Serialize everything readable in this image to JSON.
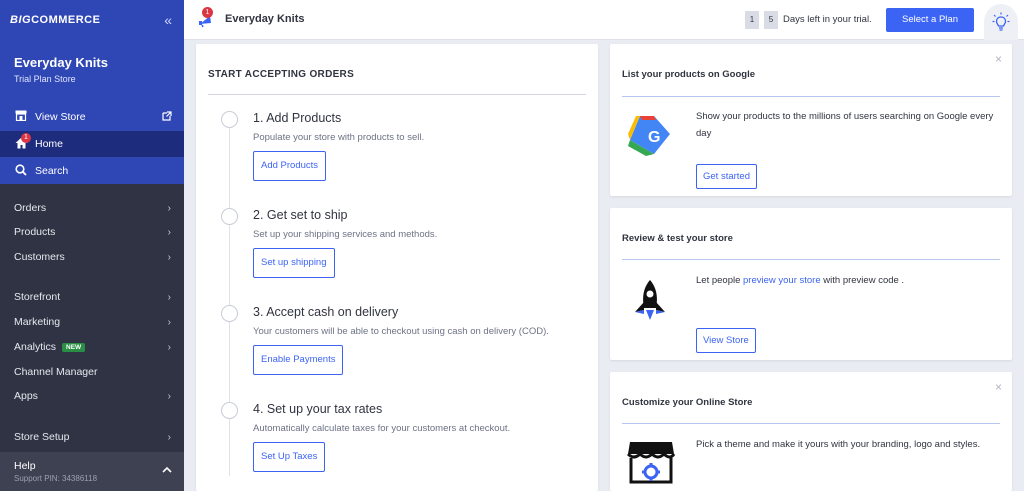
{
  "sidebar": {
    "logo_big": "BIG",
    "logo_commerce": "COMMERCE",
    "collapse_icon": "«",
    "store_name": "Everyday Knits",
    "store_plan": "Trial Plan Store",
    "view_store": "View Store",
    "home": "Home",
    "home_badge": "1",
    "search": "Search",
    "nav": [
      {
        "label": "Orders"
      },
      {
        "label": "Products"
      },
      {
        "label": "Customers"
      },
      {
        "label": "Storefront"
      },
      {
        "label": "Marketing"
      },
      {
        "label": "Analytics",
        "badge": "NEW"
      },
      {
        "label": "Channel Manager"
      },
      {
        "label": "Apps"
      },
      {
        "label": "Store Setup"
      }
    ],
    "help_label": "Help",
    "help_pin": "Support PIN: 34386118"
  },
  "topbar": {
    "notification_badge": "1",
    "title": "Everyday Knits",
    "days_digits": [
      "1",
      "5"
    ],
    "days_text": "Days left in your trial.",
    "select_plan": "Select a Plan"
  },
  "orders_card": {
    "title": "START ACCEPTING ORDERS",
    "steps": [
      {
        "title": "1. Add Products",
        "desc": "Populate your store with products to sell.",
        "button": "Add Products"
      },
      {
        "title": "2. Get set to ship",
        "desc": "Set up your shipping services and methods.",
        "button": "Set up shipping"
      },
      {
        "title": "3. Accept cash on delivery",
        "desc": "Your customers will be able to checkout using cash on delivery (COD).",
        "button": "Enable Payments"
      },
      {
        "title": "4. Set up your tax rates",
        "desc": "Automatically calculate taxes for your customers at checkout.",
        "button": "Set Up Taxes"
      }
    ]
  },
  "google_card": {
    "title": "List your products on Google",
    "text": "Show your products to the millions of users searching on Google every day",
    "button": "Get started",
    "close": "×"
  },
  "review_card": {
    "title": "Review & test your store",
    "text_before": "Let people ",
    "link": "preview your store",
    "text_after": " with preview code .",
    "button": "View Store"
  },
  "customize_card": {
    "title": "Customize your Online Store",
    "text": "Pick a theme and make it yours with your branding, logo and styles.",
    "close": "×"
  },
  "colors": {
    "accent": "#3c64f4",
    "sidebar_blue": "#2f46b5",
    "sidebar_dark": "#2f3343",
    "badge_red": "#db3643"
  }
}
